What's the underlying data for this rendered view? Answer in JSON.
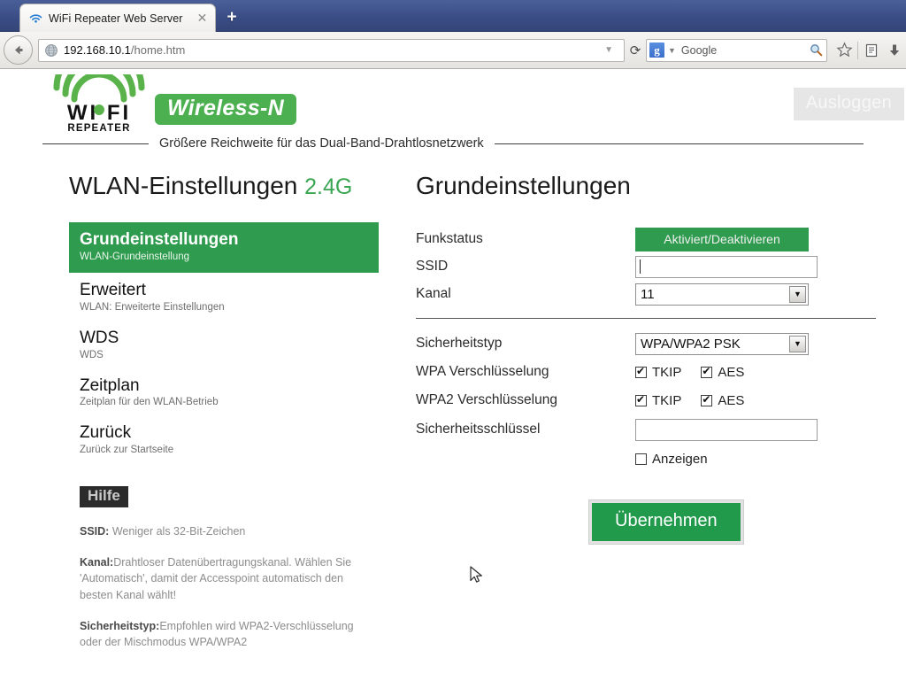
{
  "browser": {
    "tab": {
      "title": "WiFi Repeater Web Server",
      "favicon": "wifi-icon",
      "close": "✕"
    },
    "newtab_label": "+",
    "url": {
      "host": "192.168.10.1",
      "path": "/home.htm"
    },
    "url_dropdown": "▼",
    "reload": "⟳",
    "search": {
      "engine_letter": "g",
      "caret": "▼",
      "placeholder": "Google"
    },
    "icons": {
      "back": "back-arrow-icon",
      "globe": "globe-icon",
      "magnifier": "search-icon",
      "bookmark": "star-icon",
      "reader": "reader-icon",
      "download": "download-icon"
    }
  },
  "header": {
    "logo_text": "WI FI",
    "logo_sub": "REPEATER",
    "badge": "Wireless-N",
    "tagline": "Größere Reichweite für das Dual-Band-Drahtlosnetzwerk",
    "logout_label": "Ausloggen"
  },
  "sidebar": {
    "title": "WLAN-Einstellungen",
    "title_band": "2.4G",
    "items": [
      {
        "title": "Grundeinstellungen",
        "sub": "WLAN-Grundeinstellung",
        "active": true
      },
      {
        "title": "Erweitert",
        "sub": "WLAN: Erweiterte Einstellungen",
        "active": false
      },
      {
        "title": "WDS",
        "sub": "WDS",
        "active": false
      },
      {
        "title": "Zeitplan",
        "sub": "Zeitplan für den WLAN-Betrieb",
        "active": false
      },
      {
        "title": "Zurück",
        "sub": "Zurück zur Startseite",
        "active": false
      }
    ],
    "help_badge": "Hilfe",
    "help": [
      {
        "term": "SSID:",
        "text": " Weniger als 32-Bit-Zeichen"
      },
      {
        "term": "Kanal:",
        "text": "Drahtloser Datenübertragungskanal. Wählen Sie 'Automatisch', damit der Accesspoint automatisch den besten Kanal wählt!"
      },
      {
        "term": "Sicherheitstyp:",
        "text": "Empfohlen wird WPA2-Verschlüsselung oder der Mischmodus WPA/WPA2"
      }
    ]
  },
  "main": {
    "title": "Grundeinstellungen",
    "labels": {
      "radio_status": "Funkstatus",
      "ssid": "SSID",
      "channel": "Kanal",
      "security_type": "Sicherheitstyp",
      "wpa_encryption": "WPA  Verschlüsselung",
      "wpa2_encryption": "WPA2  Verschlüsselung",
      "security_key": "Sicherheitsschlüssel"
    },
    "radio_button_label": "Aktiviert/Deaktivieren",
    "ssid_value": "",
    "channel_value": "11",
    "select_caret": "▼",
    "security_type_value": "WPA/WPA2  PSK",
    "wpa": {
      "tkip_label": "TKIP",
      "tkip_checked": true,
      "aes_label": "AES",
      "aes_checked": true
    },
    "wpa2": {
      "tkip_label": "TKIP",
      "tkip_checked": true,
      "aes_label": "AES",
      "aes_checked": true
    },
    "security_key_value": "",
    "show_label": "Anzeigen",
    "show_checked": false,
    "submit_label": "Übernehmen"
  },
  "colors": {
    "green_primary": "#2e9b4f",
    "green_badge": "#4caf50",
    "green_submit": "#219a4c",
    "green_accent": "#3ba652",
    "titlebar_blue": "#3a4d85"
  }
}
